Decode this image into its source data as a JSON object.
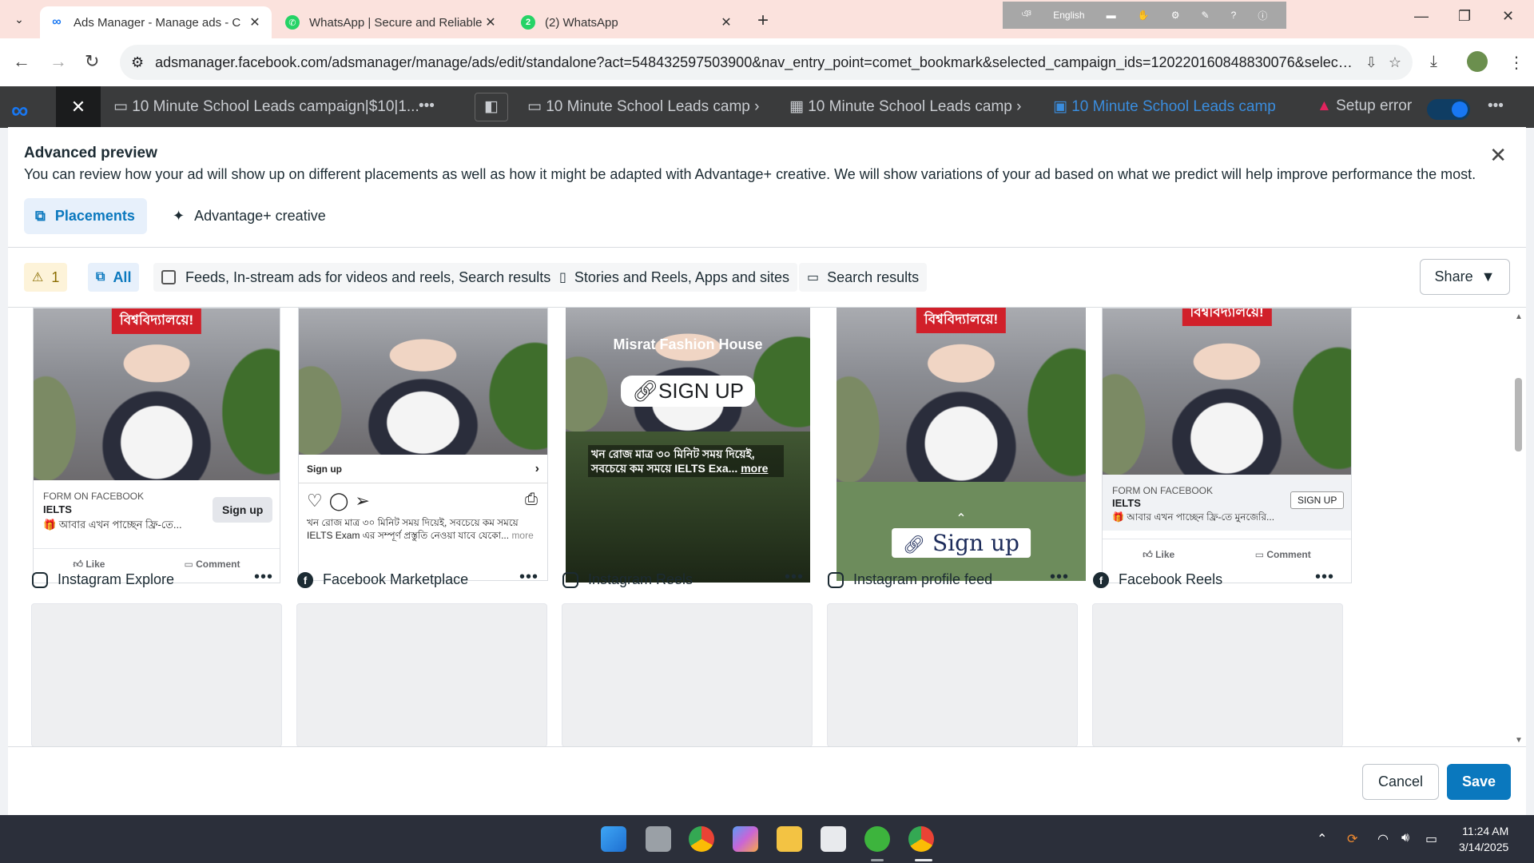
{
  "browser": {
    "tabs": [
      {
        "title": "Ads Manager - Manage ads - C",
        "favicon": "meta-icon",
        "active": true
      },
      {
        "title": "WhatsApp | Secure and Reliable",
        "favicon": "whatsapp-icon",
        "active": false
      },
      {
        "title": "(2) WhatsApp",
        "favicon": "whatsapp-icon",
        "active": false
      }
    ],
    "ime_language": "English",
    "url": "adsmanager.facebook.com/adsmanager/manage/ads/edit/standalone?act=548432597503900&nav_entry_point=comet_bookmark&selected_campaign_ids=120220160848830076&selected_..."
  },
  "app_header": {
    "campaign_tab": "10 Minute School Leads campaign|$10|1...",
    "breadcrumb": [
      "10 Minute School Leads camp",
      "10 Minute School Leads camp",
      "10 Minute School Leads camp"
    ],
    "status": "Setup error"
  },
  "modal": {
    "title": "Advanced preview",
    "subtitle": "You can review how your ad will show up on different placements as well as how it might be adapted with Advantage+ creative. We will show variations of your ad based on what we predict will help improve performance the most.",
    "tabs": [
      {
        "label": "Placements",
        "icon": "placements-icon",
        "active": true
      },
      {
        "label": "Advantage+ creative",
        "icon": "sparkle-icon",
        "active": false
      }
    ],
    "filters": {
      "warning_count": "1",
      "all": "All",
      "feeds": "Feeds, In-stream ads for videos and reels, Search results",
      "stories": "Stories and Reels, Apps and sites",
      "search": "Search results"
    },
    "share_label": "Share",
    "cancel_label": "Cancel",
    "save_label": "Save"
  },
  "previews": {
    "banner_text": "বিশ্ববিদ্যালয়ে!",
    "card1": {
      "meta": "FORM ON FACEBOOK",
      "title": "IELTS",
      "desc": "🎁 আবার এখন পাচ্ছেন ফ্রি-তে...",
      "cta": "Sign up",
      "like": "Like",
      "comment": "Comment"
    },
    "card2": {
      "signup": "Sign up",
      "caption": "খন রোজ মাত্র ৩০ মিনিট সময় দিয়েই, সবচেয়ে কম সময়ে IELTS Exam এর সম্পূর্ণ প্রস্তুতি নেওয়া যাবে যেকো...",
      "more": "more"
    },
    "card3": {
      "brand": "Misrat Fashion House",
      "cta": "SIGN UP",
      "text": "খন রোজ মাত্র ৩০ মিনিট সময় দিয়েই, সবচেয়ে কম সময়ে IELTS Exa...",
      "more": "more"
    },
    "card4": {
      "cta": "Sign up"
    },
    "card5": {
      "banner": "বিশ্ববিদ্যালয়ে!",
      "meta": "FORM ON FACEBOOK",
      "title": "IELTS",
      "desc": "🎁 আবার এখন পাচ্ছেন ফ্রি-তে মুনজেরি...",
      "cta": "SIGN UP",
      "like": "Like",
      "comment": "Comment"
    }
  },
  "placements": [
    {
      "label": "Instagram Explore",
      "icon": "instagram-icon"
    },
    {
      "label": "Facebook Marketplace",
      "icon": "facebook-icon"
    },
    {
      "label": "Instagram Reels",
      "icon": "instagram-icon"
    },
    {
      "label": "Instagram profile feed",
      "icon": "instagram-icon"
    },
    {
      "label": "Facebook Reels",
      "icon": "facebook-icon"
    }
  ],
  "taskbar": {
    "time": "11:24 AM",
    "date": "3/14/2025"
  },
  "colors": {
    "accent": "#0a78be",
    "tabbar": "#fbe2dd",
    "banner_red": "#d1202a",
    "taskbar": "#2b2f3a"
  }
}
